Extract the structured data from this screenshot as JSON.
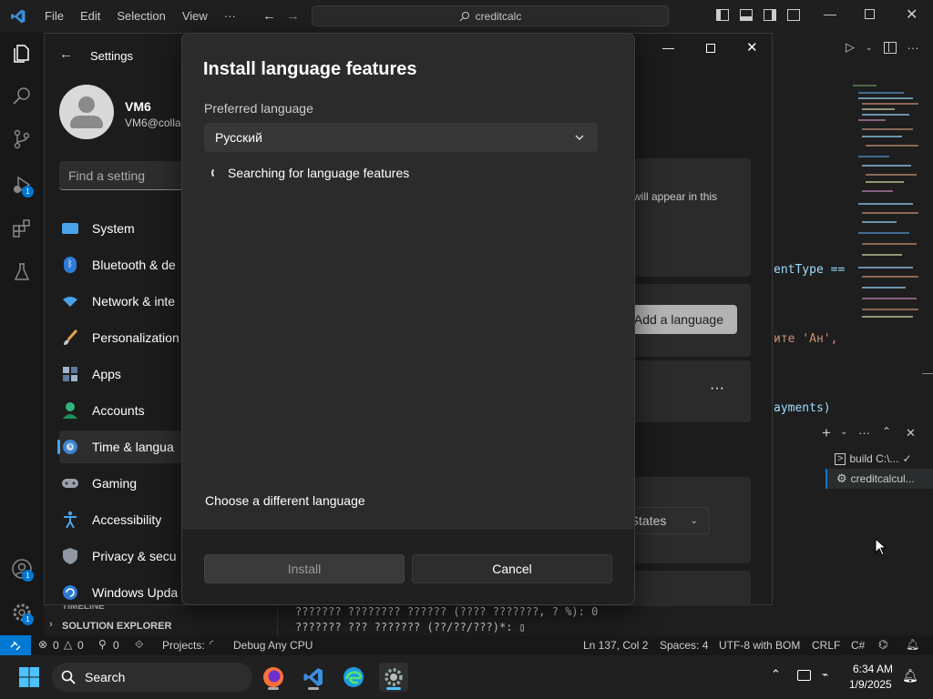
{
  "vscode": {
    "menu": [
      "File",
      "Edit",
      "Selection",
      "View",
      "···"
    ],
    "command_center": "creditcalc",
    "activity_badges": {
      "debug": "1",
      "accounts": "1",
      "manage": "1"
    },
    "code_fragments": [
      "entType ==",
      "ите 'Ан',",
      "ayments)"
    ],
    "panel": {
      "terminals": [
        {
          "label": "build C:\\...",
          "check": "✓"
        },
        {
          "label": "creditcalcul..."
        }
      ]
    },
    "terminal_lines": [
      "??????? ???????? ?????? (???? ???????, ? %): 0",
      "??????? ??? ??????? (??/??/???)*: ▯"
    ],
    "sidebar_sections": [
      "TIMELINE",
      "SOLUTION EXPLORER"
    ],
    "statusbar": {
      "errors": "0",
      "warnings": "0",
      "ports": "0",
      "projects": "Projects:",
      "config": "Debug Any CPU",
      "position": "Ln 137, Col 2",
      "spaces": "Spaces: 4",
      "encoding": "UTF-8 with BOM",
      "eol": "CRLF",
      "language": "C#"
    }
  },
  "settings": {
    "back_title": "Settings",
    "user": {
      "name": "VM6",
      "email": "VM6@colla"
    },
    "search_placeholder": "Find a setting",
    "nav": [
      {
        "label": "System",
        "icon": "system-icon"
      },
      {
        "label": "Bluetooth & de",
        "icon": "bluetooth-icon"
      },
      {
        "label": "Network & inte",
        "icon": "network-icon"
      },
      {
        "label": "Personalization",
        "icon": "brush-icon"
      },
      {
        "label": "Apps",
        "icon": "apps-icon"
      },
      {
        "label": "Accounts",
        "icon": "accounts-icon"
      },
      {
        "label": "Time & langua",
        "icon": "time-language-icon"
      },
      {
        "label": "Gaming",
        "icon": "gamepad-icon"
      },
      {
        "label": "Accessibility",
        "icon": "accessibility-icon"
      },
      {
        "label": "Privacy & secu",
        "icon": "shield-icon"
      },
      {
        "label": "Windows Upda",
        "icon": "update-icon"
      }
    ],
    "content": {
      "info_fragment": "will appear in this",
      "add_language_label": "Add a language",
      "more_label": "···",
      "region_fragment": "d States"
    }
  },
  "dialog": {
    "title": "Install language features",
    "preferred_label": "Preferred language",
    "selected_language": "Русский",
    "status": "Searching for language features",
    "different_language_link": "Choose a different language",
    "install_label": "Install",
    "cancel_label": "Cancel"
  },
  "taskbar": {
    "search_label": "Search",
    "time": "6:34 AM",
    "date": "1/9/2025"
  },
  "colors": {
    "accent": "#0078d4",
    "vscode_blue": "#3c8dde"
  }
}
